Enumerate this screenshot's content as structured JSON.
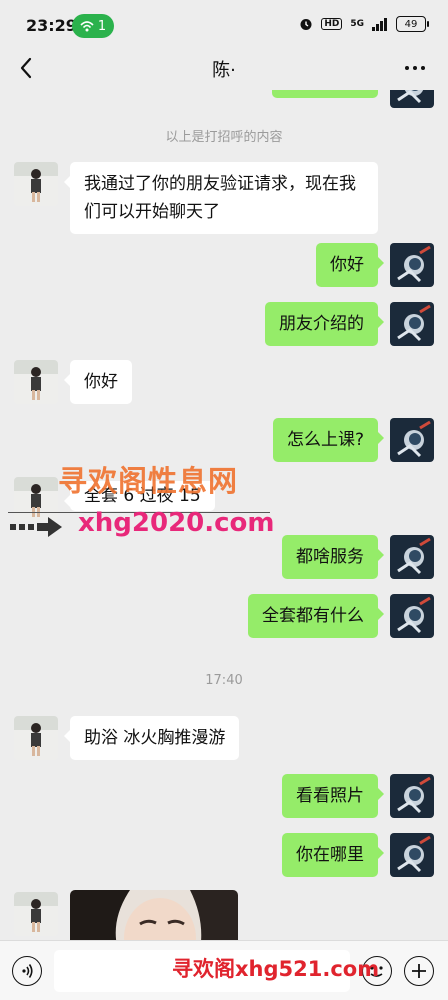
{
  "status_bar": {
    "time": "23:29",
    "hotspot_count": "1",
    "hd_label": "HD",
    "network_label": "5G",
    "battery": "49"
  },
  "nav": {
    "title": "陈·"
  },
  "chat": {
    "system_greeting": "以上是打招呼的内容",
    "timestamp": "17:40",
    "messages": [
      {
        "from": "them",
        "text": "我通过了你的朋友验证请求，现在我们可以开始聊天了"
      },
      {
        "from": "me",
        "text": "你好"
      },
      {
        "from": "me",
        "text": "朋友介绍的"
      },
      {
        "from": "them",
        "text": "你好"
      },
      {
        "from": "me",
        "text": "怎么上课?"
      },
      {
        "from": "them",
        "text": "全套 6 过夜 15"
      },
      {
        "from": "me",
        "text": "都啥服务"
      },
      {
        "from": "me",
        "text": "全套都有什么"
      },
      {
        "from": "them",
        "text": "助浴 冰火胸推漫游"
      },
      {
        "from": "me",
        "text": "看看照片"
      },
      {
        "from": "me",
        "text": "你在哪里"
      }
    ]
  },
  "watermarks": {
    "title": "寻欢阁性息网",
    "url": "xhg2020.com",
    "bottom": "寻欢阁xhg521.com"
  },
  "colors": {
    "background": "#ededed",
    "outgoing_bubble": "#95ec69",
    "incoming_bubble": "#ffffff",
    "hotspot_pill": "#2bb24c"
  }
}
